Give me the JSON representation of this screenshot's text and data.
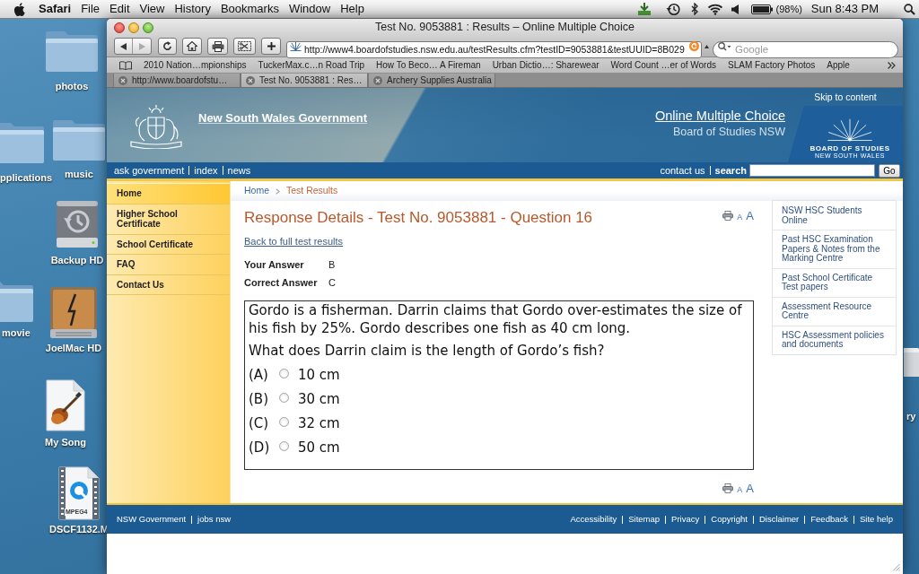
{
  "menu_bar": {
    "app_name": "Safari",
    "menus": [
      "File",
      "Edit",
      "View",
      "History",
      "Bookmarks",
      "Window",
      "Help"
    ],
    "battery_reading": "(98%)",
    "clock": "Sun 8:43 PM"
  },
  "desktop": {
    "icons": [
      {
        "kind": "folder",
        "label": "photos"
      },
      {
        "kind": "folder",
        "label": "pplications"
      },
      {
        "kind": "folder",
        "label": "music"
      },
      {
        "kind": "backup_drive",
        "label": "Backup HD"
      },
      {
        "kind": "folder",
        "label": "movie"
      },
      {
        "kind": "system_drive",
        "label": "JoelMac HD"
      },
      {
        "kind": "audio_file",
        "label": "My Song"
      },
      {
        "kind": "video_file",
        "label": "DSCF1132.M",
        "badge": "MPEG4"
      },
      {
        "kind": "document",
        "label": "ry"
      }
    ]
  },
  "browser": {
    "title": "Test No. 9053881 : Results – Online Multiple Choice",
    "address": "http://www4.boardofstudies.nsw.edu.au/testResults.cfm?testID=9053881&testUUID=8B029",
    "search": {
      "placeholder": "Google"
    },
    "bookmarks": [
      "2010 Nation…mpionships",
      "TuckerMax.c…n Road Trip",
      "How To Beco… A Fireman",
      "Urban Dictio…: Sharewear",
      "Word Count …er of Words",
      "SLAM Factory Photos",
      "Apple"
    ],
    "tabs": [
      {
        "label": "http://www.boardofstu…",
        "selected": false
      },
      {
        "label": "Test No. 9053881 : Res…",
        "selected": true
      },
      {
        "label": "Archery Supplies Australia",
        "selected": false
      }
    ]
  },
  "page": {
    "header": {
      "agency": "New South Wales Government",
      "skip_link": "Skip to content",
      "site_title": "Online Multiple Choice",
      "site_subtitle": "Board of Studies NSW",
      "logo_lines": [
        "BOARD OF STUDIES",
        "NEW SOUTH WALES"
      ]
    },
    "utility_bar": {
      "links": [
        "ask government",
        "index",
        "news"
      ],
      "contact_link": "contact us",
      "search_label": "search",
      "search_button": "Go"
    },
    "side_nav": [
      {
        "label": "Home",
        "selected": true
      },
      {
        "label": "Higher School Certificate",
        "selected": false
      },
      {
        "label": "School Certificate",
        "selected": false
      },
      {
        "label": "FAQ",
        "selected": false
      },
      {
        "label": "Contact Us",
        "selected": false
      }
    ],
    "breadcrumb": [
      "Home",
      "Test Results"
    ],
    "heading": "Response Details - Test No. 9053881 - Question 16",
    "text_size_top": {
      "small": "A",
      "large": "A"
    },
    "back_link": "Back to full test results",
    "answers": [
      {
        "label": "Your Answer",
        "value": "B"
      },
      {
        "label": "Correct Answer",
        "value": "C"
      }
    ],
    "question": {
      "paragraphs": [
        "Gordo is a fisherman. Darrin claims that Gordo over-estimates the size of his fish by 25%. Gordo describes one fish as 40 cm long.",
        "What does Darrin claim is the length of Gordo’s fish?"
      ],
      "options": [
        {
          "letter": "(A)",
          "text": "10 cm",
          "selected": false
        },
        {
          "letter": "(B)",
          "text": "30 cm",
          "selected": false
        },
        {
          "letter": "(C)",
          "text": "32 cm",
          "selected": false
        },
        {
          "letter": "(D)",
          "text": "50 cm",
          "selected": false
        }
      ]
    },
    "text_size_bottom": {
      "small": "A",
      "large": "A"
    },
    "related_links": [
      "NSW HSC Students Online",
      "Past HSC Examination Papers & Notes from the Marking Centre",
      "Past School Certificate Test papers",
      "Assessment Resource Centre",
      "HSC Assessment policies and documents"
    ],
    "footer": {
      "left_links": [
        "NSW Government",
        "jobs nsw"
      ],
      "right_links": [
        "Accessibility",
        "Sitemap",
        "Privacy",
        "Copyright",
        "Disclaimer",
        "Feedback",
        "Site help"
      ]
    }
  }
}
